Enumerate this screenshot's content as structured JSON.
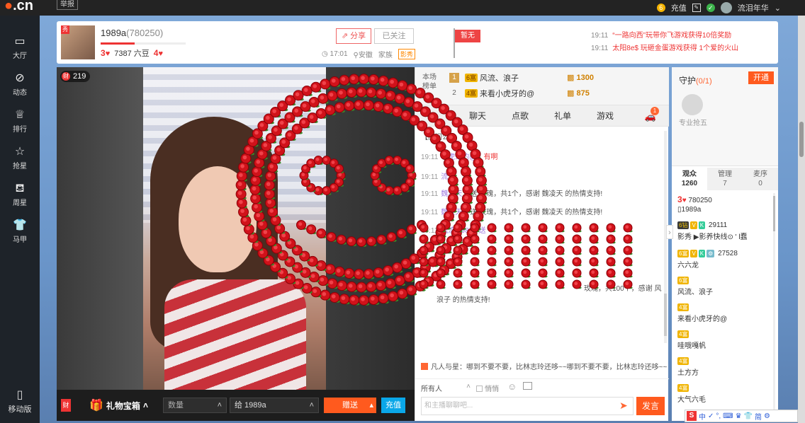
{
  "topbar": {
    "logo": ".cn",
    "report": "举报",
    "coin_count": "6",
    "recharge": "充值",
    "username": "流泪年华"
  },
  "sidebar": {
    "items": [
      {
        "label": "大厅",
        "icon": "tv-icon"
      },
      {
        "label": "动态",
        "icon": "compass-icon"
      },
      {
        "label": "排行",
        "icon": "crown-icon"
      },
      {
        "label": "抢星",
        "icon": "star-icon"
      },
      {
        "label": "周星",
        "icon": "cup-icon"
      },
      {
        "label": "马甲",
        "icon": "shirt-icon"
      }
    ],
    "mobile": "移动版"
  },
  "header": {
    "host_name": "1989a",
    "host_id": "(780250)",
    "level_left": "3",
    "beans": "7387 六豆",
    "level_right": "4",
    "share": "分享",
    "follow": "已关注",
    "time": "17:01",
    "location": "安徽",
    "family": "家族",
    "family_tag": "影秀",
    "flag": "暂无",
    "notices": [
      {
        "time": "19:11",
        "text": "“一路向西”玩带你飞游戏获得10倍奖励"
      },
      {
        "time": "19:11",
        "text": "太阳8e$ 玩砸金蛋游戏获得 1个爱的火山"
      }
    ]
  },
  "video": {
    "viewer_count": "219"
  },
  "giftbar": {
    "fan": "财",
    "giftbox": "礼物宝箱",
    "qty_placeholder": "数量",
    "recipient": "给  1989a",
    "send": "赠送",
    "recharge": "充值"
  },
  "rank": {
    "title": "本场榜单",
    "rows": [
      {
        "num": "1",
        "badge": "6富",
        "name": "风流、浪子",
        "score": "1300"
      },
      {
        "num": "2",
        "badge": "4富",
        "name": "来看小虎牙的@",
        "score": "875"
      }
    ]
  },
  "chat_tabs": [
    "聊天",
    "点歌",
    "礼单",
    "游戏"
  ],
  "car_badge": "1",
  "chat": {
    "room_notice": "【房间公",
    "messages": [
      {
        "time": "19:11",
        "user": "小虎牙的@",
        "text": "：有啊"
      },
      {
        "time": "19:11",
        "user": "流泪",
        "text": ""
      },
      {
        "time": "19:11",
        "user": "魏凌天",
        "text": "a 送  玫瑰，共1个，感谢 魏凌天 的热情支持!"
      },
      {
        "time": "19:11",
        "user": "魏凌天",
        "text": "a 送  玫瑰，共1个，感谢 魏凌天 的热情支持!"
      },
      {
        "time": "19:11",
        "user": "风流",
        "text": "1989a 送"
      },
      {
        "time": "",
        "user": "",
        "text": "玫瑰，共100个，感谢 风"
      },
      {
        "time": "",
        "user": "",
        "text": "浪子 的热情支持!"
      }
    ],
    "bullet": "凡人与星：哪到不要不要，比林志玲还哆~~哪到不要不要，比林志玲还哆~~",
    "target": "所有人",
    "private": "悄悄",
    "input_placeholder": "和主播聊聊吧...",
    "send": "发言"
  },
  "guard": {
    "title": "守护",
    "count": "(0/1)",
    "open": "开通",
    "label": "专业抢五"
  },
  "audience_tabs": [
    {
      "label": "观众",
      "count": "1260"
    },
    {
      "label": "管理",
      "count": "7"
    },
    {
      "label": "麦序",
      "count": "0"
    }
  ],
  "audience": [
    {
      "badge": "3",
      "id": "780250",
      "name": "1989a"
    },
    {
      "badge": "6钻",
      "id": "29111",
      "name": "影秀 ▶影养快线⊙ ' l蠢"
    },
    {
      "badge": "6富",
      "id": "27528",
      "name": "六六龙"
    },
    {
      "badge": "6富",
      "id": "",
      "name": "风流、浪子"
    },
    {
      "badge": "4富",
      "id": "",
      "name": "来看小虎牙的@"
    },
    {
      "badge": "4富",
      "id": "",
      "name": "哇哦嘎帆"
    },
    {
      "badge": "4富",
      "id": "",
      "name": "土方方"
    },
    {
      "badge": "4富",
      "id": "",
      "name": "大气六毛"
    }
  ],
  "ime": [
    "中",
    "✓",
    "°,",
    "⌨",
    "♛",
    "👕",
    "简",
    "⚙"
  ]
}
